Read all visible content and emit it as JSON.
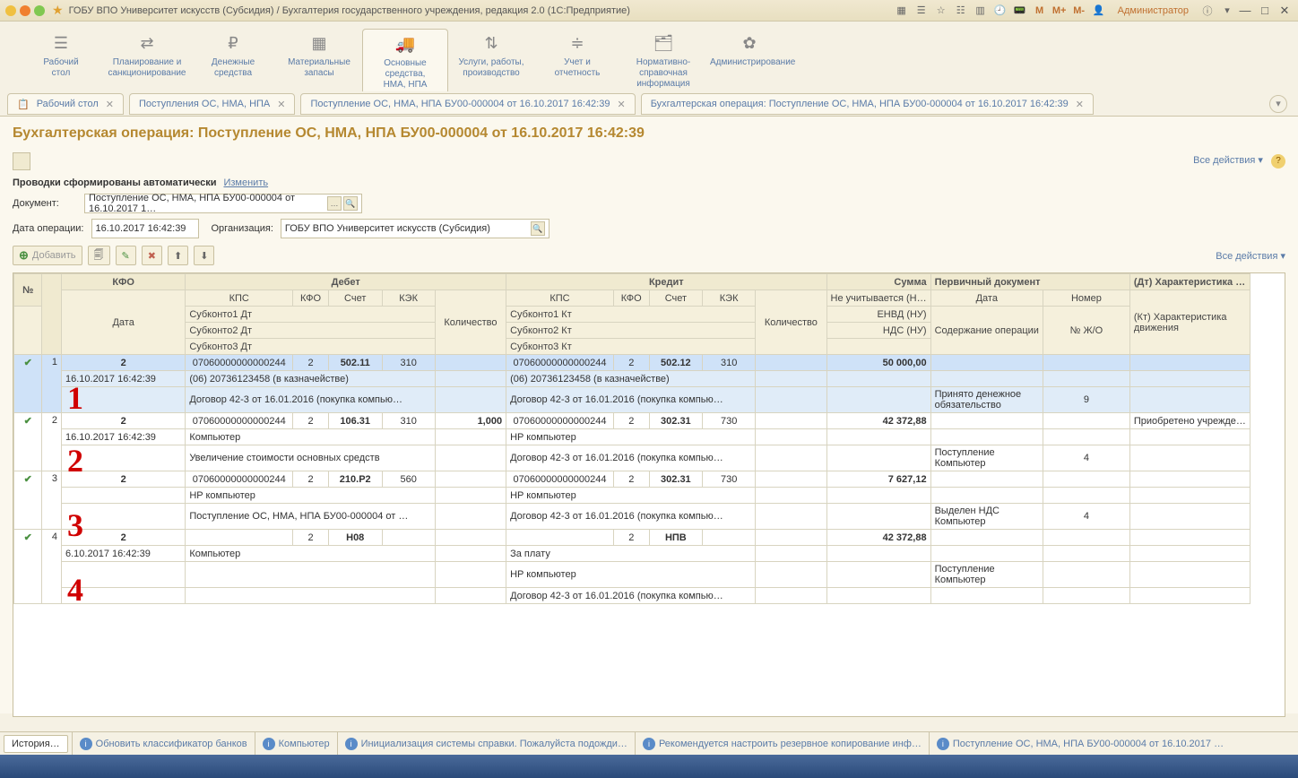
{
  "titlebar": {
    "title": "ГОБУ ВПО Университет искусств (Субсидия) / Бухгалтерия государственного учреждения, редакция 2.0  (1С:Предприятие)",
    "m1": "M",
    "m2": "M+",
    "m3": "M-",
    "admin": "Администратор"
  },
  "nav": [
    {
      "icon": "☰",
      "label": "Рабочий\nстол"
    },
    {
      "icon": "⇄",
      "label": "Планирование и\nсанкционирование"
    },
    {
      "icon": "₽",
      "label": "Денежные\nсредства"
    },
    {
      "icon": "▦",
      "label": "Материальные\nзапасы"
    },
    {
      "icon": "🚚",
      "label": "Основные средства,\nНМА, НПА",
      "active": true
    },
    {
      "icon": "⇅",
      "label": "Услуги, работы,\nпроизводство"
    },
    {
      "icon": "≑",
      "label": "Учет и\nотчетность"
    },
    {
      "icon": "🗂",
      "label": "Нормативно-справочная\nинформация"
    },
    {
      "icon": "✿",
      "label": "Администрирование"
    }
  ],
  "tabs": [
    {
      "label": "Рабочий стол",
      "icon": "🗔",
      "close": true
    },
    {
      "label": "Поступления ОС, НМА, НПА",
      "close": true
    },
    {
      "label": "Поступление ОС, НМА, НПА БУ00-000004 от 16.10.2017 16:42:39",
      "close": true
    },
    {
      "label": "Бухгалтерская операция: Поступление ОС, НМА, НПА БУ00-000004 от 16.10.2017 16:42:39",
      "close": true
    }
  ],
  "page": {
    "title": "Бухгалтерская операция: Поступление ОС, НМА, НПА БУ00-000004 от 16.10.2017 16:42:39",
    "all_actions": "Все действия",
    "provodki_label": "Проводки сформированы автоматически",
    "change_link": "Изменить",
    "doc_label": "Документ:",
    "doc_value": "Поступление ОС, НМА, НПА БУ00-000004 от 16.10.2017 1…",
    "date_label": "Дата операции:",
    "date_value": "16.10.2017 16:42:39",
    "org_label": "Организация:",
    "org_value": "ГОБУ ВПО Университет искусств (Субсидия)",
    "add_btn": "Добавить"
  },
  "headers": {
    "r1": [
      "№",
      "",
      "КФО",
      "Дебет",
      "Кредит",
      "Сумма",
      "Первичный документ",
      "(Дт) Характеристика …"
    ],
    "r2": [
      "",
      "",
      "Дата",
      "КПС",
      "КФО",
      "Счет",
      "КЭК",
      "Количество",
      "КПС",
      "КФО",
      "Счет",
      "КЭК",
      "Количество",
      "Не учитывается (Н…",
      "Дата",
      "Номер",
      "(Кт) Характеристика\nдвижения"
    ],
    "r3": [
      "",
      "",
      "",
      "Субконто1 Дт",
      "",
      "",
      "",
      "",
      "Субконто1 Кт",
      "",
      "",
      "",
      "",
      "ЕНВД (НУ)",
      "Содержание операции",
      "№ Ж/О",
      ""
    ],
    "r4": [
      "",
      "",
      "",
      "Субконто2 Дт",
      "",
      "",
      "",
      "",
      "Субконто2 Кт",
      "",
      "",
      "",
      "",
      "НДС (НУ)",
      "",
      "",
      ""
    ],
    "r5": [
      "",
      "",
      "",
      "Субконто3 Дт",
      "",
      "",
      "",
      "",
      "Субконто3 Кт",
      "",
      "",
      "",
      "",
      "",
      "",
      "",
      ""
    ]
  },
  "rows": [
    {
      "n": "1",
      "kfo": "2",
      "date": "16.10.2017 16:42:39",
      "d_kps": "07060000000000244",
      "d_kfo": "2",
      "d_sch": "502.11",
      "d_kek": "310",
      "k_kps": "07060000000000244",
      "k_kfo": "2",
      "k_sch": "502.12",
      "k_kek": "310",
      "sum": "50 000,00",
      "d_s1": "(06) 20736123458 (в казначействе)",
      "k_s1": "(06) 20736123458 (в казначействе)",
      "d_s2": "Договор 42-3 от 16.01.2016 (покупка компью…",
      "k_s2": "Договор 42-3 от 16.01.2016 (покупка компью…",
      "op": "Принято денежное\nобязательство",
      "jo": "9",
      "marker": "1",
      "selected": true
    },
    {
      "n": "2",
      "kfo": "2",
      "date": "16.10.2017 16:42:39",
      "d_kps": "07060000000000244",
      "d_kfo": "2",
      "d_sch": "106.31",
      "d_kek": "310",
      "d_qty": "1,000",
      "k_kps": "07060000000000244",
      "k_kfo": "2",
      "k_sch": "302.31",
      "k_kek": "730",
      "sum": "42 372,88",
      "char": "Приобретено учрежде…",
      "d_s1": "Компьютер",
      "k_s1": "HP компьютер",
      "d_s2": "Увеличение стоимости основных средств",
      "k_s2": "Договор 42-3 от 16.01.2016 (покупка компью…",
      "op": "Поступление Компьютер",
      "jo": "4",
      "marker": "2"
    },
    {
      "n": "3",
      "kfo": "2",
      "date": "",
      "d_kps": "07060000000000244",
      "d_kfo": "2",
      "d_sch": "210.Р2",
      "d_kek": "560",
      "k_kps": "07060000000000244",
      "k_kfo": "2",
      "k_sch": "302.31",
      "k_kek": "730",
      "sum": "7 627,12",
      "d_s1": "HP компьютер",
      "k_s1": "HP компьютер",
      "d_s2": "Поступление ОС, НМА, НПА БУ00-000004 от …",
      "k_s2": "Договор 42-3 от 16.01.2016 (покупка компью…",
      "op": "Выделен НДС Компьютер",
      "jo": "4",
      "marker": "3"
    },
    {
      "n": "4",
      "kfo": "2",
      "date": "6.10.2017 16:42:39",
      "d_kps": "",
      "d_kfo": "2",
      "d_sch": "H08",
      "d_kek": "",
      "k_kps": "",
      "k_kfo": "2",
      "k_sch": "НПВ",
      "k_kek": "",
      "sum": "42 372,88",
      "d_s1": "Компьютер",
      "k_s1": "За плату",
      "d_s2": "",
      "k_s2": "HP компьютер",
      "k_s3": "Договор 42-3 от 16.01.2016 (покупка компью…",
      "op": "Поступление Компьютер",
      "jo": "",
      "marker": "4"
    }
  ],
  "status": {
    "history": "История…",
    "items": [
      "Обновить классификатор банков",
      "Компьютер",
      "Инициализация системы справки. Пожалуйста подожди…",
      "Рекомендуется настроить резервное копирование инф…",
      "Поступление ОС, НМА, НПА БУ00-000004 от 16.10.2017 …"
    ]
  }
}
